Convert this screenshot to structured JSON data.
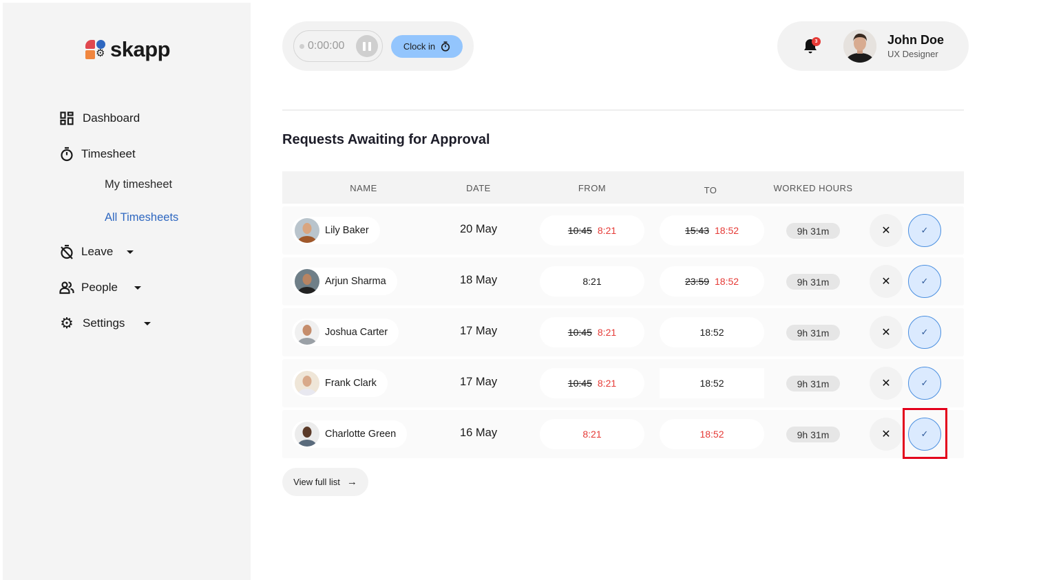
{
  "app": {
    "logo_text": "skapp"
  },
  "sidebar": {
    "items": [
      {
        "label": "Dashboard",
        "icon": "dashboard-icon"
      },
      {
        "label": "Timesheet",
        "icon": "stopwatch-icon",
        "expanded": true,
        "children": [
          {
            "label": "My timesheet",
            "active": false
          },
          {
            "label": "All Timesheets",
            "active": true
          }
        ]
      },
      {
        "label": "Leave",
        "icon": "leave-icon",
        "has_dropdown": true
      },
      {
        "label": "People",
        "icon": "people-icon",
        "has_dropdown": true
      },
      {
        "label": "Settings",
        "icon": "gear-icon",
        "has_dropdown": true
      }
    ]
  },
  "header": {
    "timer": {
      "value": "0:00:00",
      "pause_icon": "pause-icon"
    },
    "clock_in_label": "Clock in",
    "notifications": {
      "count": "3"
    },
    "user": {
      "name": "John Doe",
      "role": "UX Designer"
    }
  },
  "main": {
    "title": "Requests Awaiting for Approval",
    "columns": [
      "NAME",
      "DATE",
      "FROM",
      "TO",
      "WORKED HOURS"
    ],
    "rows": [
      {
        "name": "Lily Baker",
        "date": "20 May",
        "from_old": "10:45",
        "from_new": "8:21",
        "to_old": "15:43",
        "to_new": "18:52",
        "worked": "9h 31m"
      },
      {
        "name": "Arjun Sharma",
        "date": "18 May",
        "from_old": "",
        "from_new": "8:21",
        "to_old": "23:59",
        "to_new": "18:52",
        "worked": "9h 31m"
      },
      {
        "name": "Joshua Carter",
        "date": "17 May",
        "from_old": "10:45",
        "from_new": "8:21",
        "to_old": "",
        "to_new": "18:52",
        "worked": "9h 31m"
      },
      {
        "name": "Frank Clark",
        "date": "17 May",
        "from_old": "10:45",
        "from_new": "8:21",
        "to_old": "",
        "to_new": "18:52",
        "worked": "9h 31m"
      },
      {
        "name": "Charlotte Green",
        "date": "16 May",
        "from_old": "",
        "from_new": "8:21",
        "to_old": "",
        "to_new": "18:52",
        "worked": "9h 31m"
      }
    ],
    "reject_symbol": "✕",
    "approve_symbol": "✓",
    "view_full_list_label": "View full list",
    "arrow_symbol": "→"
  },
  "colors": {
    "accent_blue": "#2e67c0",
    "clock_in_bg": "#93c5fd",
    "changed_time_red": "#e53935",
    "approve_bg": "#dbeafe"
  }
}
